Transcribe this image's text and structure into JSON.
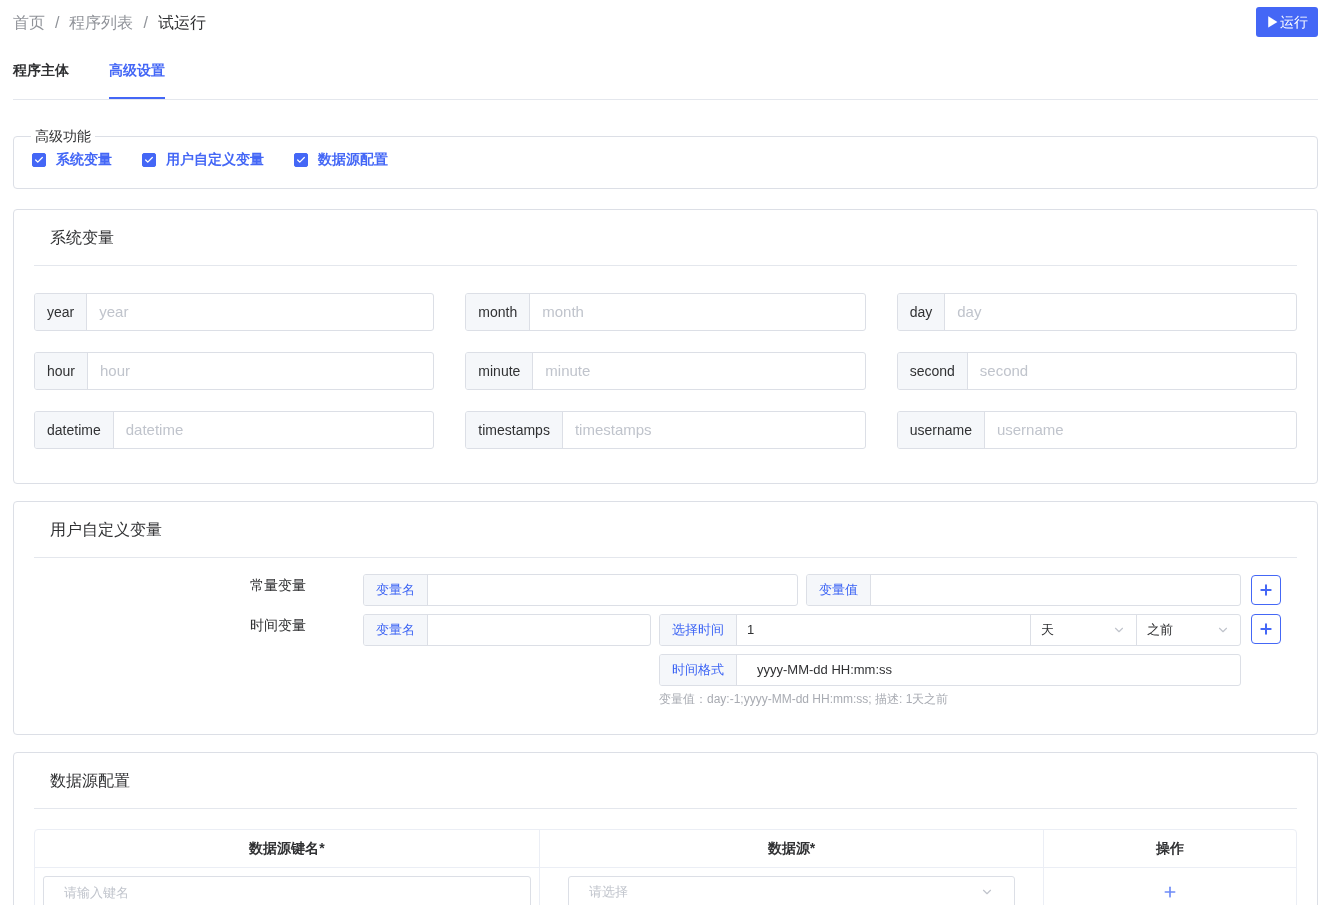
{
  "breadcrumb": {
    "items": [
      "首页",
      "程序列表",
      "试运行"
    ],
    "separator": "/"
  },
  "run_button": "▶运行",
  "tabs": [
    {
      "label": "程序主体",
      "selected": false
    },
    {
      "label": "高级设置",
      "selected": true
    }
  ],
  "advanced": {
    "legend": "高级功能",
    "options": [
      {
        "label": "系统变量",
        "checked": true
      },
      {
        "label": "用户自定义变量",
        "checked": true
      },
      {
        "label": "数据源配置",
        "checked": true
      }
    ]
  },
  "system_vars": {
    "title": "系统变量",
    "fields": [
      {
        "label": "year",
        "placeholder": "year"
      },
      {
        "label": "month",
        "placeholder": "month"
      },
      {
        "label": "day",
        "placeholder": "day"
      },
      {
        "label": "hour",
        "placeholder": "hour"
      },
      {
        "label": "minute",
        "placeholder": "minute"
      },
      {
        "label": "second",
        "placeholder": "second"
      },
      {
        "label": "datetime",
        "placeholder": "datetime"
      },
      {
        "label": "timestamps",
        "placeholder": "timestamps"
      },
      {
        "label": "username",
        "placeholder": "username"
      }
    ]
  },
  "user_vars": {
    "title": "用户自定义变量",
    "constant": {
      "label": "常量变量",
      "name_addon": "变量名",
      "value_addon": "变量值"
    },
    "time": {
      "label": "时间变量",
      "name_addon": "变量名",
      "time_addon": "选择时间",
      "time_value": "1",
      "unit": "天",
      "direction": "之前",
      "format_addon": "时间格式",
      "format_value": "yyyy-MM-dd HH:mm:ss",
      "hint": "变量值：day:-1;yyyy-MM-dd HH:mm:ss; 描述: 1天之前"
    }
  },
  "datasource": {
    "title": "数据源配置",
    "columns": [
      "数据源键名*",
      "数据源*",
      "操作"
    ],
    "row": {
      "key_placeholder": "请输入键名",
      "source_placeholder": "请选择"
    }
  }
}
